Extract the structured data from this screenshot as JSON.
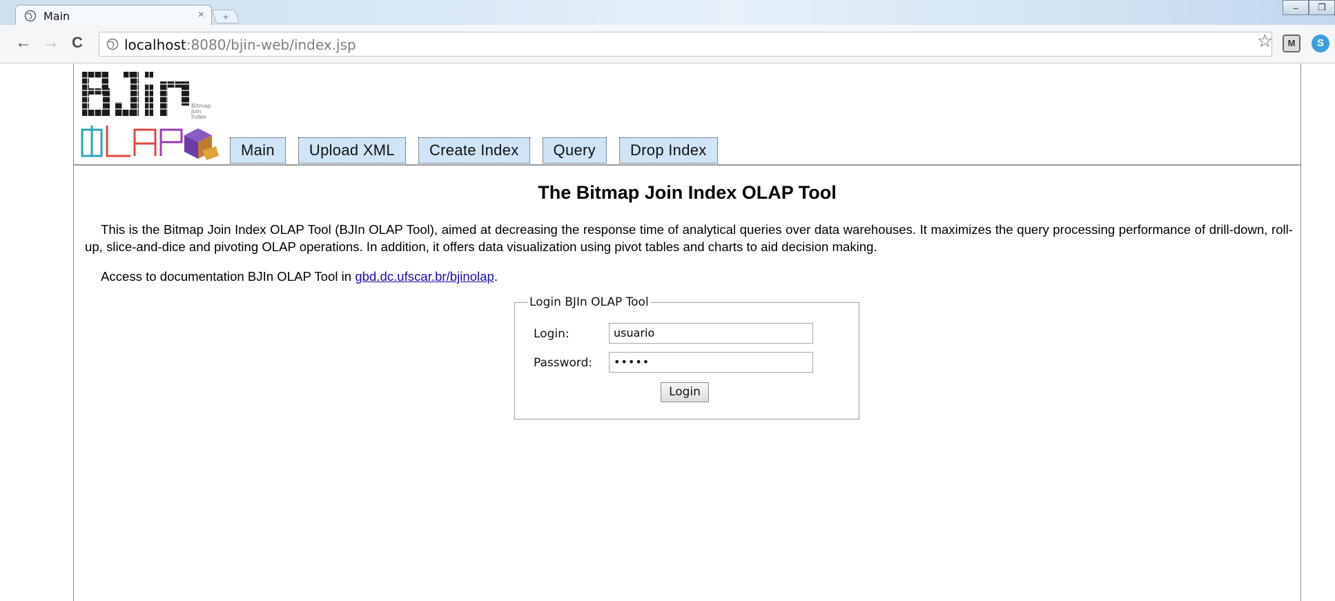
{
  "browser": {
    "tab_title": "Main",
    "tab_close": "×",
    "new_tab": "+",
    "url_host": "localhost",
    "url_rest": ":8080/bjin-web/index.jsp",
    "back": "←",
    "forward": "→",
    "reload": "C",
    "star": "☆",
    "window_controls": [
      "–",
      "❐"
    ]
  },
  "nav": {
    "items": [
      "Main",
      "Upload XML",
      "Create Index",
      "Query",
      "Drop Index"
    ]
  },
  "logo": {
    "big_text": "BJIn",
    "small_text": [
      "Bitmap",
      "Join",
      "Index"
    ],
    "bottom_text": "OLAP"
  },
  "content": {
    "title": "The Bitmap Join Index OLAP Tool",
    "intro": "This is the Bitmap Join Index OLAP Tool (BJIn OLAP Tool), aimed at decreasing the response time of analytical queries over data warehouses. It maximizes the query processing performance of drill-down, roll-up, slice-and-dice and pivoting OLAP operations. In addition, it offers data visualization using pivot tables and charts to aid decision making.",
    "doc_prefix": "Access to documentation BJIn OLAP Tool in ",
    "doc_link": "gbd.dc.ufscar.br/bjinolap",
    "doc_suffix": "."
  },
  "login": {
    "legend": "Login BJIn OLAP Tool",
    "login_label": "Login:",
    "login_value": "usuario",
    "password_label": "Password:",
    "password_value": "•••••",
    "button": "Login"
  },
  "colors": {
    "nav_bg": "#cfe4f6",
    "link": "#1a0dab",
    "logo_cyan": "#27a7b8",
    "logo_red": "#e0473b",
    "logo_purple": "#9b39b8"
  }
}
